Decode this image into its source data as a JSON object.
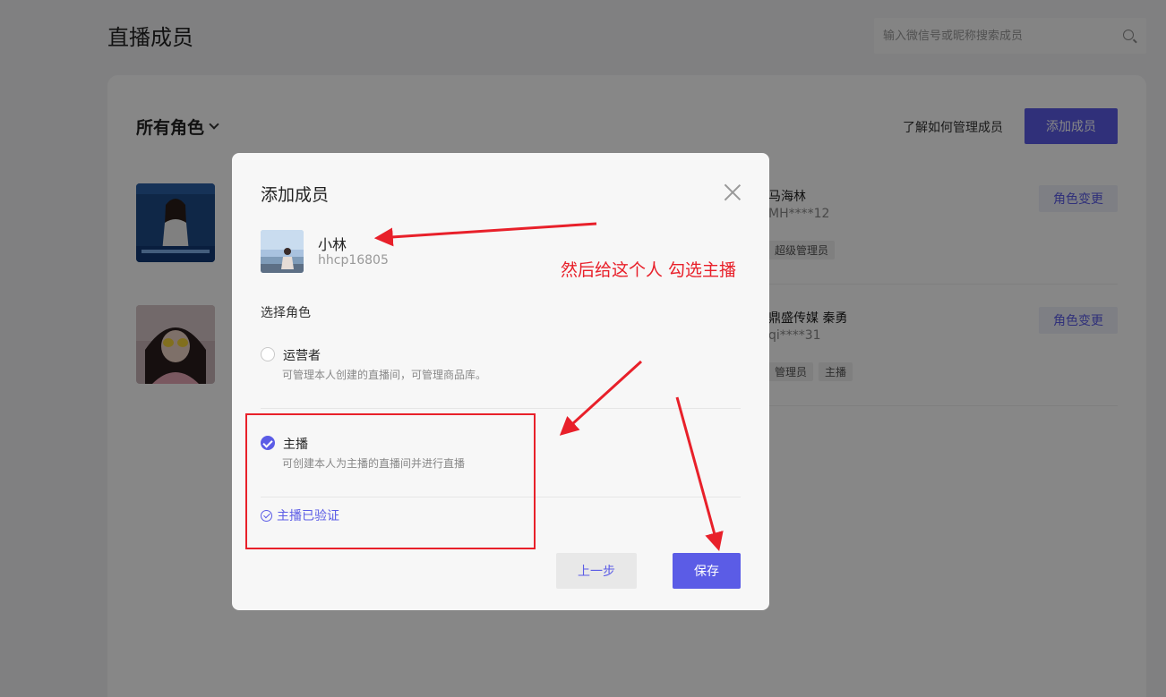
{
  "page": {
    "title": "直播成员",
    "search_placeholder": "输入微信号或昵称搜索成员",
    "role_filter": "所有角色",
    "learn_link": "了解如何管理成员",
    "add_member_button": "添加成员"
  },
  "members": [
    {
      "name": "马海林",
      "wechat": "MH****12",
      "tags": [
        "超级管理员"
      ],
      "action": "角色变更"
    },
    {
      "name": "鼎盛传媒 秦勇",
      "wechat": "qi****31",
      "tags": [
        "管理员",
        "主播"
      ],
      "action": "角色变更"
    }
  ],
  "modal": {
    "title": "添加成员",
    "user": {
      "name": "小林",
      "id": "hhcp16805"
    },
    "section_label": "选择角色",
    "roles": [
      {
        "name": "运营者",
        "desc": "可管理本人创建的直播间，可管理商品库。",
        "checked": false
      },
      {
        "name": "主播",
        "desc": "可创建本人为主播的直播间并进行直播",
        "checked": true
      }
    ],
    "verified_text": "主播已验证",
    "prev_button": "上一步",
    "save_button": "保存"
  },
  "annotation": {
    "text": "然后给这个人 勾选主播",
    "color": "#e8202a"
  },
  "colors": {
    "accent": "#5b5ce6"
  }
}
